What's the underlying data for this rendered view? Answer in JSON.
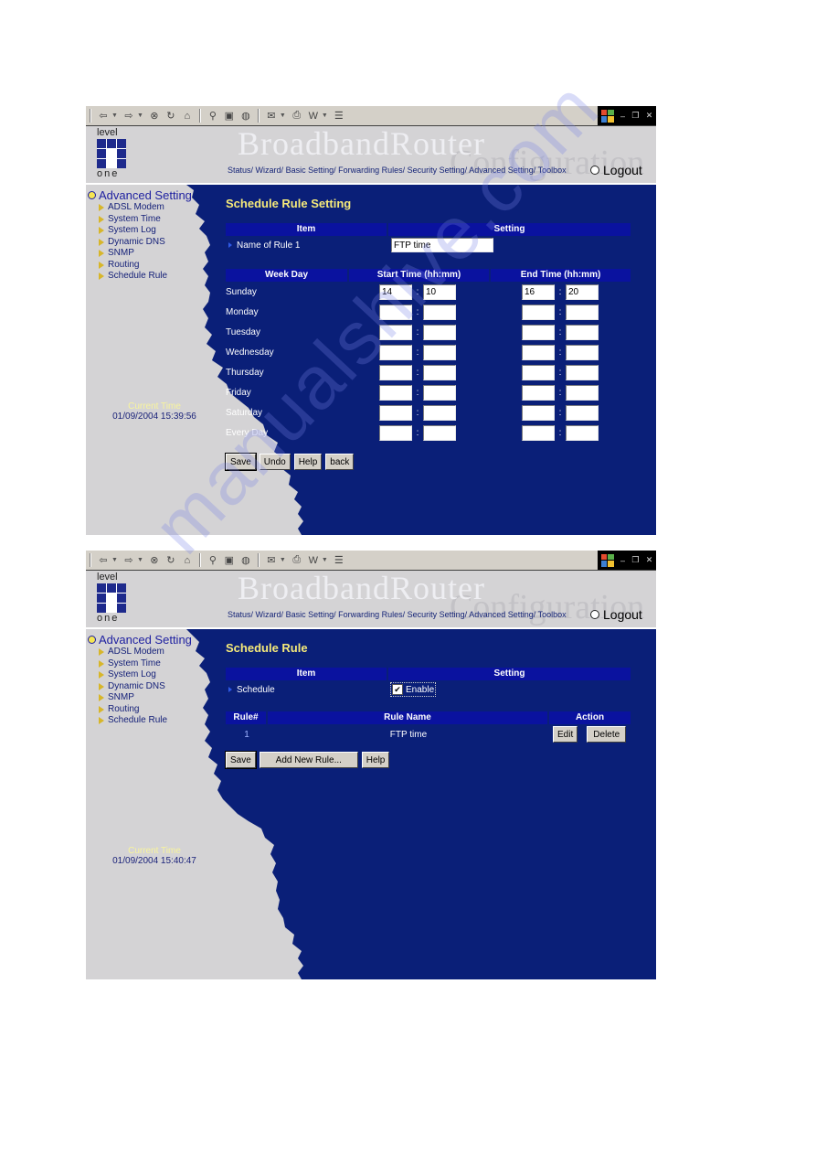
{
  "colors": {
    "main_bg": "#0a1f78",
    "sidebar_bg": "#d4d3d5",
    "header_bar": "#0a129f",
    "title_yellow": "#f6ea7a",
    "link_blue": "#152477"
  },
  "browser": {
    "toolbar_icons": [
      "back-icon",
      "forward-icon",
      "stop-icon",
      "refresh-icon",
      "home-icon",
      "search-icon",
      "favorites-icon",
      "history-icon",
      "mail-icon",
      "print-icon",
      "edit-icon",
      "discuss-icon"
    ],
    "window_controls": [
      "minimize",
      "restore",
      "close"
    ]
  },
  "header": {
    "logo_top": "level",
    "logo_bottom": "one",
    "brand": "BroadbandRouter",
    "brand_sub": "Configuration",
    "nav": [
      "Status/",
      "Wizard/",
      "Basic Setting/",
      "Forwarding Rules/",
      "Security Setting/",
      "Advanced Setting/",
      "Toolbox"
    ],
    "logout": "Logout"
  },
  "sidebar": {
    "title": "Advanced Setting",
    "items": [
      "ADSL Modem",
      "System Time",
      "System Log",
      "Dynamic DNS",
      "SNMP",
      "Routing",
      "Schedule Rule"
    ],
    "current_time_label": "Current Time"
  },
  "screen1": {
    "current_time": "01/09/2004 15:39:56",
    "title": "Schedule Rule Setting",
    "item_header": "Item",
    "setting_header": "Setting",
    "name_label": "Name of Rule 1",
    "name_value": "FTP time",
    "week_header": "Week Day",
    "start_header": "Start Time (hh:mm)",
    "end_header": "End Time (hh:mm)",
    "days": [
      {
        "day": "Sunday",
        "start_h": "14",
        "start_m": "10",
        "end_h": "16",
        "end_m": "20"
      },
      {
        "day": "Monday",
        "start_h": "",
        "start_m": "",
        "end_h": "",
        "end_m": ""
      },
      {
        "day": "Tuesday",
        "start_h": "",
        "start_m": "",
        "end_h": "",
        "end_m": ""
      },
      {
        "day": "Wednesday",
        "start_h": "",
        "start_m": "",
        "end_h": "",
        "end_m": ""
      },
      {
        "day": "Thursday",
        "start_h": "",
        "start_m": "",
        "end_h": "",
        "end_m": ""
      },
      {
        "day": "Friday",
        "start_h": "",
        "start_m": "",
        "end_h": "",
        "end_m": ""
      },
      {
        "day": "Saturday",
        "start_h": "",
        "start_m": "",
        "end_h": "",
        "end_m": ""
      },
      {
        "day": "Every Day",
        "start_h": "",
        "start_m": "",
        "end_h": "",
        "end_m": ""
      }
    ],
    "colon": ":",
    "buttons": {
      "save": "Save",
      "undo": "Undo",
      "help": "Help",
      "back": "back"
    }
  },
  "screen2": {
    "current_time": "01/09/2004 15:40:47",
    "title": "Schedule Rule",
    "item_header": "Item",
    "setting_header": "Setting",
    "schedule_label": "Schedule",
    "enable_label": "Enable",
    "enable_checked": true,
    "rule_no_header": "Rule#",
    "rule_name_header": "Rule Name",
    "action_header": "Action",
    "rules": [
      {
        "no": "1",
        "name": "FTP time"
      }
    ],
    "edit": "Edit",
    "delete": "Delete",
    "buttons": {
      "save": "Save",
      "add": "Add New Rule...",
      "help": "Help"
    }
  },
  "watermark": "manualshive.com"
}
